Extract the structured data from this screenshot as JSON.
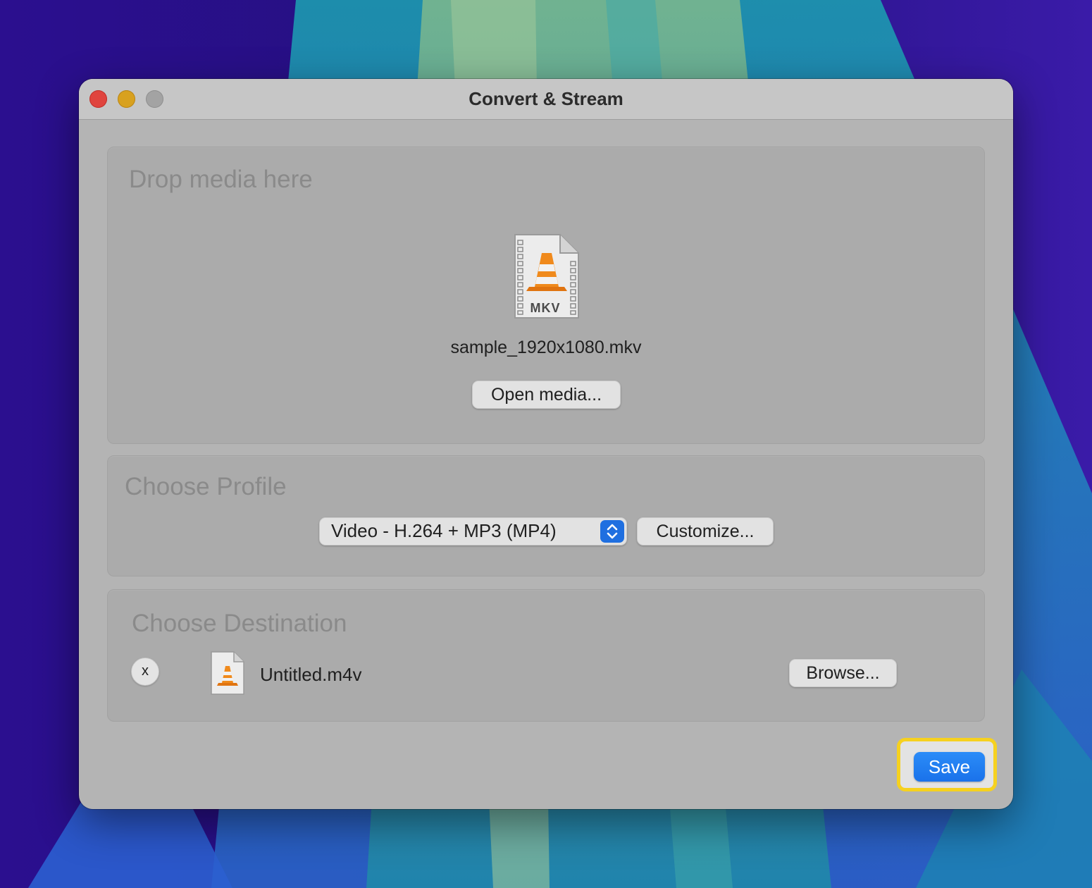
{
  "window": {
    "title": "Convert & Stream"
  },
  "source": {
    "heading": "Drop media here",
    "file_badge": "MKV",
    "file_name": "sample_1920x1080.mkv",
    "open_button": "Open media..."
  },
  "profile": {
    "heading": "Choose Profile",
    "selected": "Video - H.264 + MP3 (MP4)",
    "customize_button": "Customize..."
  },
  "destination": {
    "heading": "Choose Destination",
    "remove_button": "x",
    "file_name": "Untitled.m4v",
    "browse_button": "Browse..."
  },
  "actions": {
    "save_button": "Save"
  },
  "colors": {
    "accent": "#1a72ea",
    "highlight": "#f6d11f",
    "cone_orange": "#f08a1c"
  }
}
